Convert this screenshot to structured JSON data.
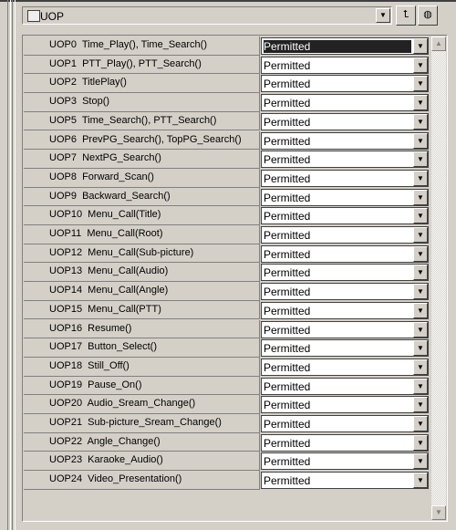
{
  "header": {
    "title": "UOP",
    "folder_icon": "folder-icon",
    "up_button_icon": "up-folder-icon",
    "globe_button_icon": "globe-icon"
  },
  "rows": [
    {
      "label": "UOP0  Time_Play(), Time_Search()",
      "value": "Permitted",
      "selected": true
    },
    {
      "label": "UOP1  PTT_Play(), PTT_Search()",
      "value": "Permitted"
    },
    {
      "label": "UOP2  TitlePlay()",
      "value": "Permitted"
    },
    {
      "label": "UOP3  Stop()",
      "value": "Permitted"
    },
    {
      "label": "UOP5  Time_Search(), PTT_Search()",
      "value": "Permitted"
    },
    {
      "label": "UOP6  PrevPG_Search(), TopPG_Search()",
      "value": "Permitted"
    },
    {
      "label": "UOP7  NextPG_Search()",
      "value": "Permitted"
    },
    {
      "label": "UOP8  Forward_Scan()",
      "value": "Permitted"
    },
    {
      "label": "UOP9  Backward_Search()",
      "value": "Permitted"
    },
    {
      "label": "UOP10  Menu_Call(Title)",
      "value": "Permitted"
    },
    {
      "label": "UOP11  Menu_Call(Root)",
      "value": "Permitted"
    },
    {
      "label": "UOP12  Menu_Call(Sub-picture)",
      "value": "Permitted"
    },
    {
      "label": "UOP13  Menu_Call(Audio)",
      "value": "Permitted"
    },
    {
      "label": "UOP14  Menu_Call(Angle)",
      "value": "Permitted"
    },
    {
      "label": "UOP15  Menu_Call(PTT)",
      "value": "Permitted"
    },
    {
      "label": "UOP16  Resume()",
      "value": "Permitted"
    },
    {
      "label": "UOP17  Button_Select()",
      "value": "Permitted"
    },
    {
      "label": "UOP18  Still_Off()",
      "value": "Permitted"
    },
    {
      "label": "UOP19  Pause_On()",
      "value": "Permitted"
    },
    {
      "label": "UOP20  Audio_Sream_Change()",
      "value": "Permitted"
    },
    {
      "label": "UOP21  Sub-picture_Sream_Change()",
      "value": "Permitted"
    },
    {
      "label": "UOP22  Angle_Change()",
      "value": "Permitted"
    },
    {
      "label": "UOP23  Karaoke_Audio()",
      "value": "Permitted"
    },
    {
      "label": "UOP24  Video_Presentation()",
      "value": "Permitted"
    }
  ]
}
